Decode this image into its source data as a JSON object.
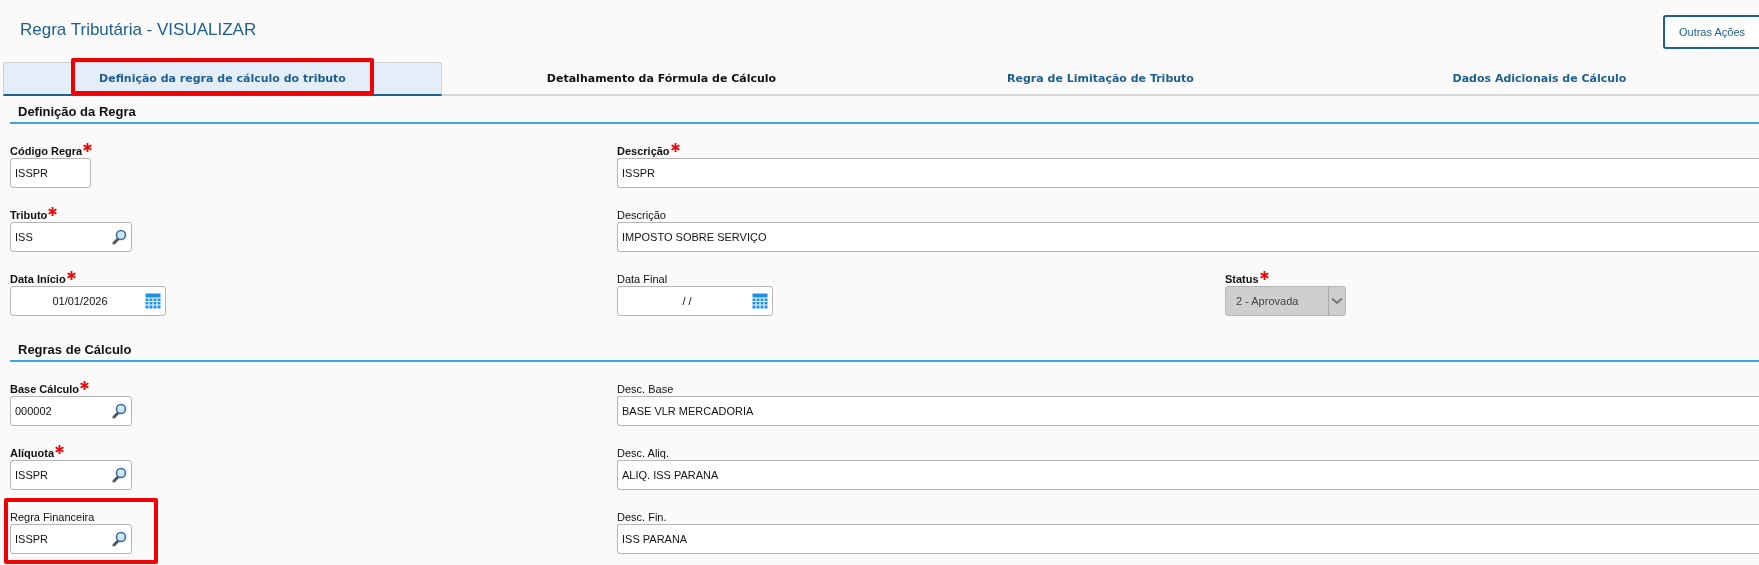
{
  "title": "Regra Tributária - VISUALIZAR",
  "actions_button": "Outras Ações",
  "tabs": [
    {
      "label": "Definição da regra de cálculo do tributo",
      "selected": true,
      "hovered": false,
      "highlighted": true
    },
    {
      "label": "Detalhamento da Fórmula de Cálculo",
      "selected": false,
      "hovered": true,
      "highlighted": false
    },
    {
      "label": "Regra de Limitação de Tributo",
      "selected": false,
      "hovered": false,
      "highlighted": false
    },
    {
      "label": "Dados Adicionais de Cálculo",
      "selected": false,
      "hovered": false,
      "highlighted": false
    }
  ],
  "sections": [
    {
      "title": "Definição da Regra",
      "rows": [
        [
          {
            "kind": "code",
            "label": "Código Regra",
            "required": true,
            "value": "ISSPR",
            "highlighted": false
          },
          {
            "kind": "text",
            "label": "Descrição",
            "required": true,
            "value": "ISSPR",
            "highlighted": false
          }
        ],
        [
          {
            "kind": "lookup",
            "label": "Tributo",
            "required": true,
            "value": "ISS",
            "highlighted": false
          },
          {
            "kind": "text",
            "label": "Descrição",
            "required": false,
            "value": "IMPOSTO SOBRE SERVIÇO",
            "highlighted": false
          }
        ],
        [
          {
            "kind": "date",
            "label": "Data Início",
            "required": true,
            "value": "01/01/2026",
            "highlighted": false
          },
          {
            "kind": "date",
            "label": "Data Final",
            "required": false,
            "value": "/ /",
            "highlighted": false
          },
          {
            "kind": "select",
            "label": "Status",
            "required": true,
            "value": "2 - Aprovada",
            "disabled": true,
            "highlighted": false
          }
        ]
      ]
    },
    {
      "title": "Regras de Cálculo",
      "rows": [
        [
          {
            "kind": "lookup",
            "label": "Base Cálculo",
            "required": true,
            "value": "000002",
            "highlighted": false
          },
          {
            "kind": "text",
            "label": "Desc. Base",
            "required": false,
            "value": "BASE VLR MERCADORIA",
            "highlighted": false
          }
        ],
        [
          {
            "kind": "lookup",
            "label": "Alíquota",
            "required": true,
            "value": "ISSPR",
            "highlighted": false
          },
          {
            "kind": "text",
            "label": "Desc. Aliq.",
            "required": false,
            "value": "ALIQ. ISS PARANA",
            "highlighted": false
          }
        ],
        [
          {
            "kind": "lookup",
            "label": "Regra Financeira",
            "required": false,
            "value": "ISSPR",
            "highlighted": true
          },
          {
            "kind": "text",
            "label": "Desc. Fin.",
            "required": false,
            "value": "ISS PARANA",
            "highlighted": false
          }
        ]
      ]
    }
  ]
}
